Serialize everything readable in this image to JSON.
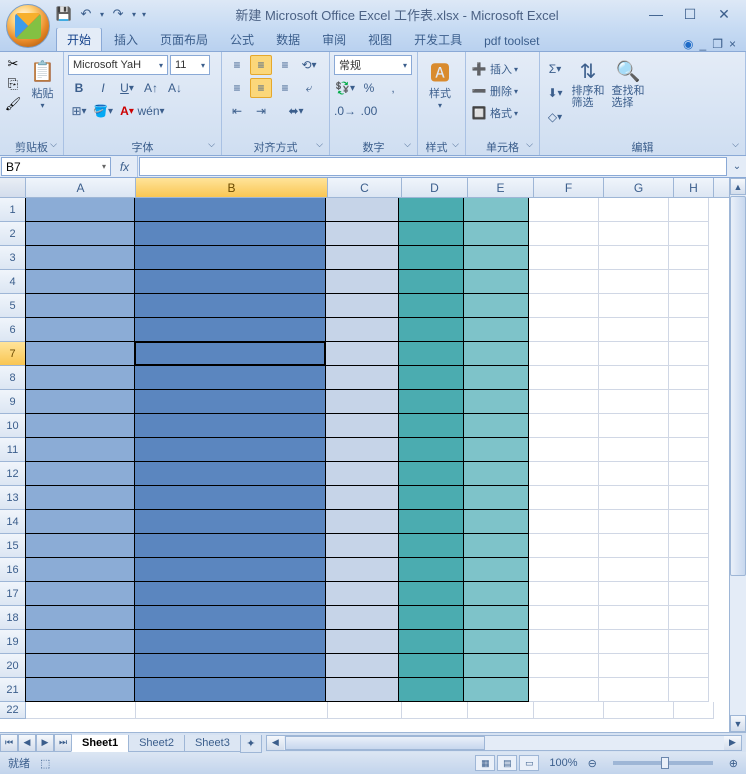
{
  "title": "新建 Microsoft Office Excel 工作表.xlsx - Microsoft Excel",
  "qat": {
    "save": "💾",
    "undo": "↶",
    "redo": "↷"
  },
  "tabs": [
    "开始",
    "插入",
    "页面布局",
    "公式",
    "数据",
    "审阅",
    "视图",
    "开发工具",
    "pdf toolset"
  ],
  "active_tab": 0,
  "ribbon": {
    "clipboard": {
      "label": "剪贴板",
      "paste": "粘贴"
    },
    "font": {
      "label": "字体",
      "name": "Microsoft YaH",
      "size": "11"
    },
    "align": {
      "label": "对齐方式"
    },
    "number": {
      "label": "数字",
      "format": "常规"
    },
    "styles": {
      "label": "样式",
      "btn": "样式"
    },
    "cells": {
      "label": "单元格",
      "insert": "插入",
      "delete": "删除",
      "format": "格式"
    },
    "editing": {
      "label": "编辑",
      "sort": "排序和\n筛选",
      "find": "查找和\n选择"
    }
  },
  "namebox": "B7",
  "fx": "fx",
  "columns": [
    "A",
    "B",
    "C",
    "D",
    "E",
    "F",
    "G",
    "H"
  ],
  "selected_col": "B",
  "rows": [
    1,
    2,
    3,
    4,
    5,
    6,
    7,
    8,
    9,
    10,
    11,
    12,
    13,
    14,
    15,
    16,
    17,
    18,
    19,
    20,
    21,
    22
  ],
  "selected_row": 7,
  "fill_last_row": 21,
  "sheets": [
    "Sheet1",
    "Sheet2",
    "Sheet3"
  ],
  "active_sheet": 0,
  "status": {
    "ready": "就绪",
    "zoom": "100%"
  }
}
